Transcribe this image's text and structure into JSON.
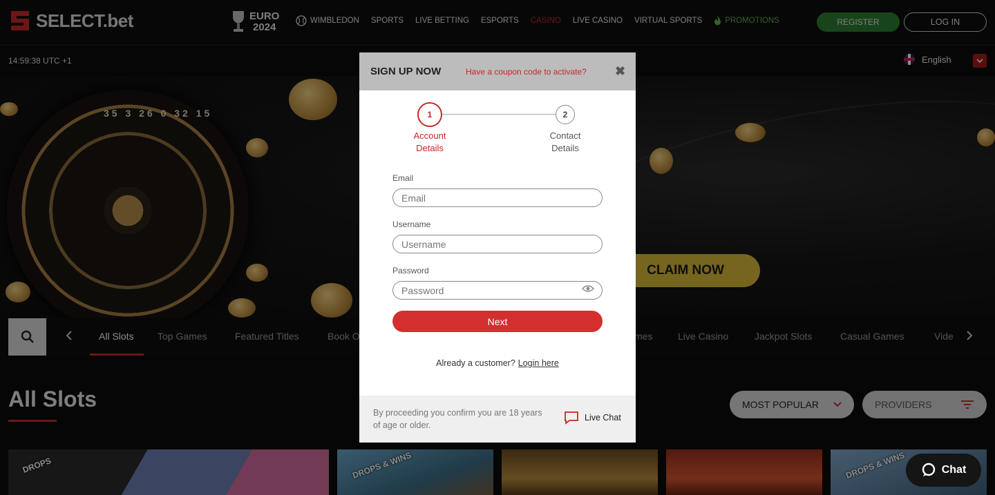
{
  "brand": {
    "name": "SELECT",
    "dot_suffix": ".bet",
    "euro_line1": "EURO",
    "euro_line2": "2024"
  },
  "nav": {
    "items": [
      {
        "label": "WIMBLEDON",
        "icon": "tennis-ball-icon"
      },
      {
        "label": "SPORTS"
      },
      {
        "label": "LIVE BETTING"
      },
      {
        "label": "ESPORTS"
      },
      {
        "label": "CASINO",
        "active": true
      },
      {
        "label": "LIVE CASINO"
      },
      {
        "label": "VIRTUAL SPORTS"
      },
      {
        "label": "PROMOTIONS",
        "icon": "flame-icon"
      }
    ],
    "register_label": "REGISTER",
    "login_label": "LOG IN"
  },
  "subbar": {
    "time": "14:59:38 UTC +1",
    "language": "English"
  },
  "hero": {
    "cta_label": "CLAIM NOW",
    "wheel_numbers": "35 3 26 0 32 15"
  },
  "categories": {
    "items": [
      "All Slots",
      "Top Games",
      "Featured Titles",
      "Book O",
      "Live Casino",
      "Jackpot Slots",
      "Casual Games",
      "Vide"
    ],
    "hidden_partial": "mes",
    "active": "All Slots"
  },
  "section": {
    "title": "All Slots",
    "sort_label": "MOST POPULAR",
    "providers_label": "PROVIDERS"
  },
  "tiles": {
    "badge": "DROPS & WINS",
    "badge_partial": "DROPS"
  },
  "modal": {
    "title": "SIGN UP NOW",
    "coupon_link": "Have a coupon code to activate?",
    "steps": [
      {
        "number": "1",
        "line1": "Account",
        "line2": "Details"
      },
      {
        "number": "2",
        "line1": "Contact",
        "line2": "Details"
      }
    ],
    "fields": {
      "email_label": "Email",
      "email_placeholder": "Email",
      "username_label": "Username",
      "username_placeholder": "Username",
      "password_label": "Password",
      "password_placeholder": "Password"
    },
    "next_label": "Next",
    "already_text": "Already a customer?",
    "login_link": "Login here",
    "age_notice": "By proceeding you confirm you are 18 years of age or older.",
    "live_chat_label": "Live Chat"
  },
  "chat_widget": {
    "label": "Chat"
  },
  "colors": {
    "accent_red": "#c62828",
    "register_green": "#2e7d32",
    "promo_green": "#5ab24a",
    "claim_yellow": "#d6b83a"
  }
}
